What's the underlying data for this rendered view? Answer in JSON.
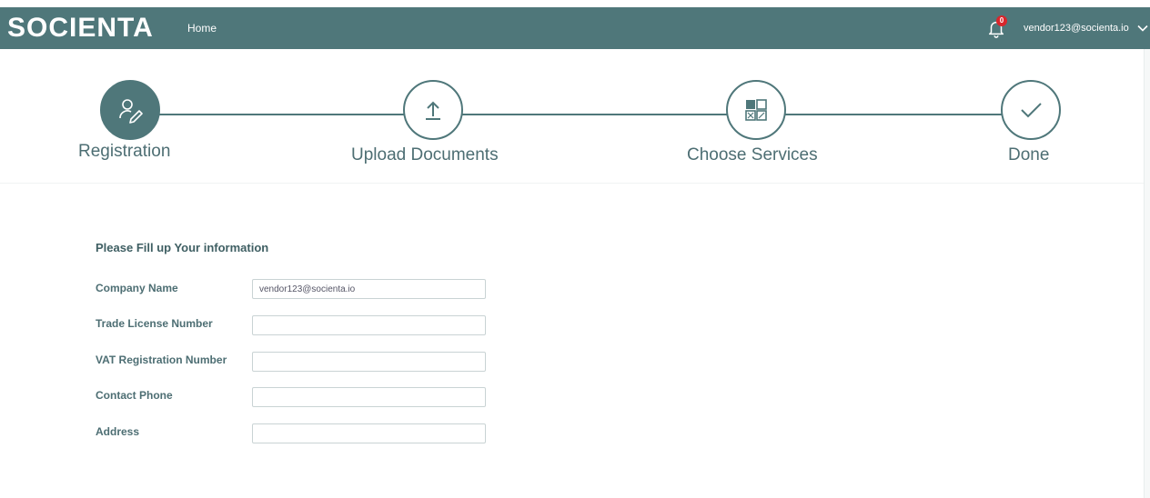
{
  "header": {
    "logo": "SOCIENTA",
    "home_label": "Home",
    "notification_count": "0",
    "user_email": "vendor123@socienta.io",
    "bg_color": "#4f777a"
  },
  "steps": [
    {
      "label": "Registration",
      "icon": "user-edit-icon",
      "active": true
    },
    {
      "label": "Upload Documents",
      "icon": "upload-icon",
      "active": false
    },
    {
      "label": "Choose Services",
      "icon": "grid-icon",
      "active": false
    },
    {
      "label": "Done",
      "icon": "check-icon",
      "active": false
    }
  ],
  "form": {
    "title": "Please Fill up Your information",
    "fields": [
      {
        "label": "Company Name",
        "value": "vendor123@socienta.io",
        "placeholder": ""
      },
      {
        "label": "Trade License Number",
        "value": "",
        "placeholder": ""
      },
      {
        "label": "VAT Registration Number",
        "value": "",
        "placeholder": ""
      },
      {
        "label": "Contact Phone",
        "value": "",
        "placeholder": ""
      },
      {
        "label": "Address",
        "value": "",
        "placeholder": ""
      }
    ]
  }
}
